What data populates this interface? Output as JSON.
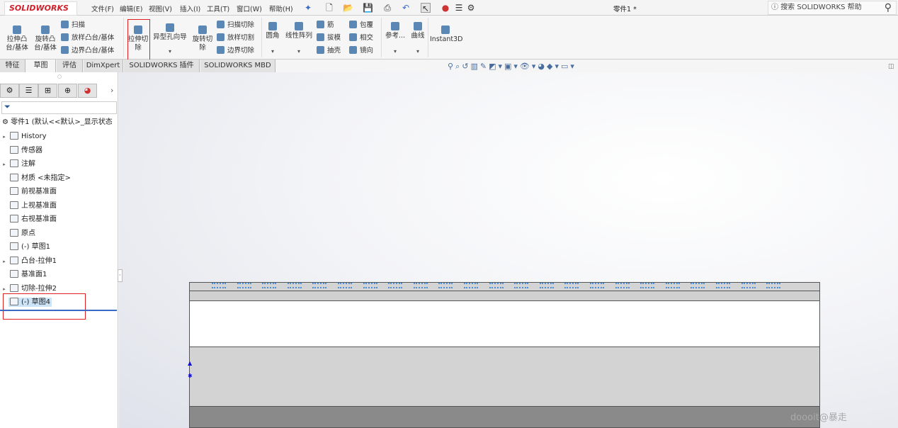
{
  "app": {
    "logo": "SOLIDWORKS",
    "document_title": "零件1 *",
    "search_placeholder": "搜索 SOLIDWORKS 帮助"
  },
  "menu": [
    "文件(F)",
    "编辑(E)",
    "视图(V)",
    "插入(I)",
    "工具(T)",
    "窗口(W)",
    "帮助(H)"
  ],
  "ribbon": {
    "extrude_boss": "拉伸凸台/基体",
    "revolve_boss": "旋转凸台/基体",
    "sweep": "扫描",
    "loft_boss": "放样凸台/基体",
    "boundary_boss": "边界凸台/基体",
    "extrude_cut": "拉伸切除",
    "hole_wizard": "异型孔向导",
    "revolve_cut": "旋转切除",
    "sweep_cut": "扫描切除",
    "loft_cut": "放样切割",
    "boundary_cut": "边界切除",
    "fillet": "圆角",
    "linear_pattern": "线性阵列",
    "rib": "筋",
    "draft": "拔模",
    "shell": "抽壳",
    "wrap": "包覆",
    "intersect": "相交",
    "mirror": "镜向",
    "reference": "参考...",
    "curves": "曲线",
    "instant3d": "Instant3D"
  },
  "tabs": [
    "特征",
    "草图",
    "评估",
    "DimXpert",
    "SOLIDWORKS 插件",
    "SOLIDWORKS MBD"
  ],
  "active_tab": "草图",
  "tree": {
    "root": "零件1 (默认<<默认>_显示状态",
    "items": [
      {
        "label": "History",
        "expand": true
      },
      {
        "label": "传感器",
        "expand": false
      },
      {
        "label": "注解",
        "expand": true
      },
      {
        "label": "材质 <未指定>",
        "expand": false
      },
      {
        "label": "前视基准面",
        "expand": false
      },
      {
        "label": "上视基准面",
        "expand": false
      },
      {
        "label": "右视基准面",
        "expand": false
      },
      {
        "label": "原点",
        "expand": false
      },
      {
        "label": "(-) 草图1",
        "expand": false
      },
      {
        "label": "凸台-拉伸1",
        "expand": true
      },
      {
        "label": "基准面1",
        "expand": false
      },
      {
        "label": "切除-拉伸2",
        "expand": true
      },
      {
        "label": "(-) 草图4",
        "expand": false,
        "selected": true
      }
    ]
  },
  "watermark": "doooit@暴走",
  "colors": {
    "highlight": "#e02020",
    "sketch": "#4a8fe0",
    "selection": "#cde3f6"
  }
}
